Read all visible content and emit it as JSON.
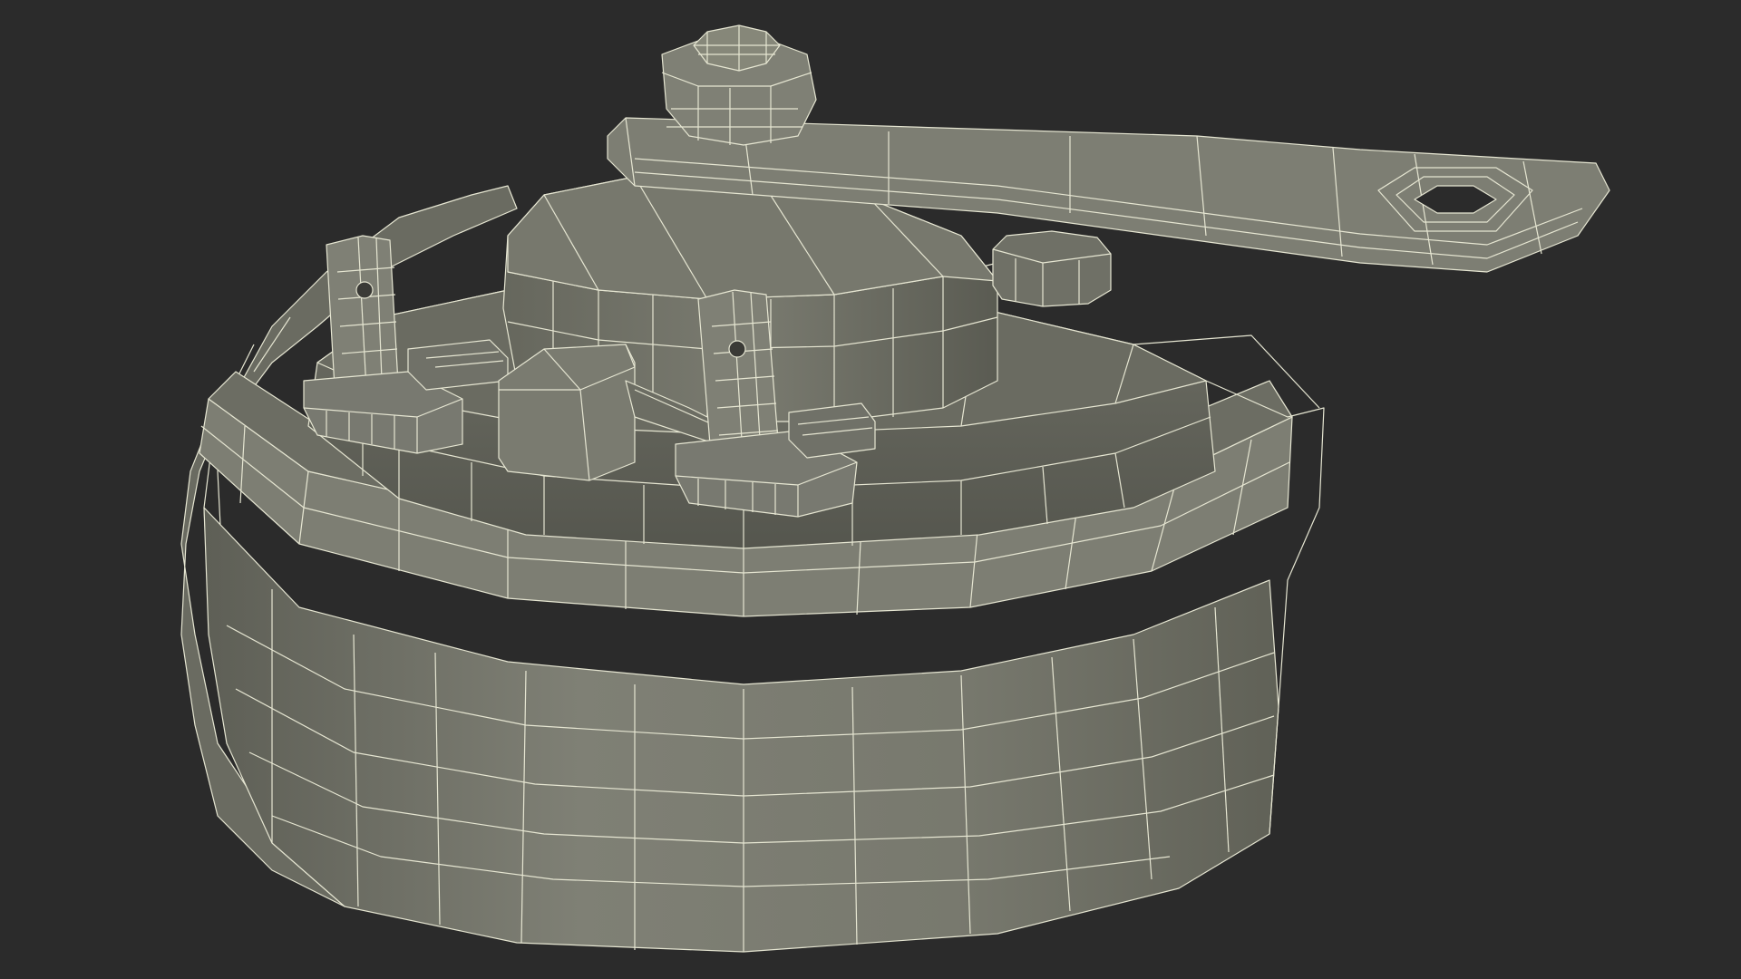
{
  "scene": {
    "background": "#2b2b2b",
    "surface_color": "#7c7d72",
    "surface_shadow": "#5c5d54",
    "surface_light": "#8f9085",
    "wire_color": "#e6e6d2"
  }
}
